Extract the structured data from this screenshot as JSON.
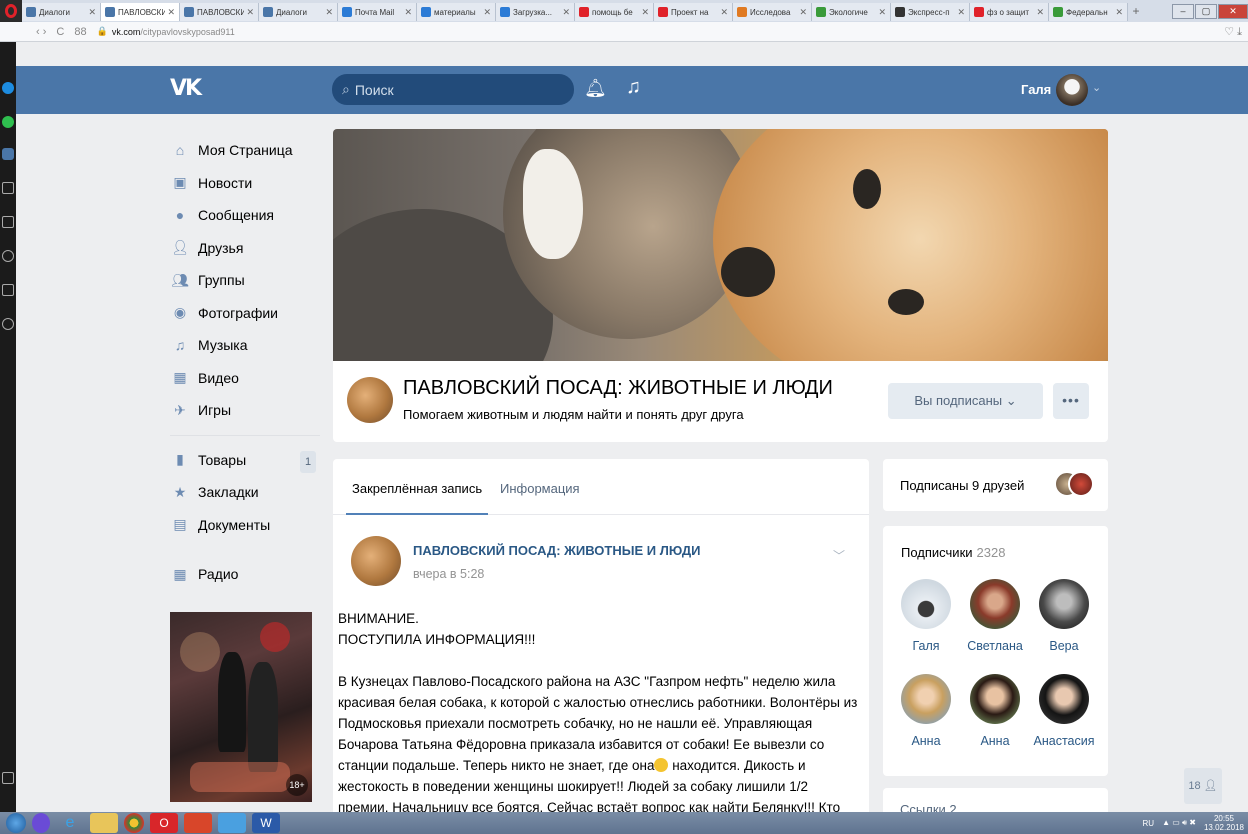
{
  "browser": {
    "tabs": [
      {
        "label": "Диалоги",
        "color": "#4a76a8"
      },
      {
        "label": "ПАВЛОВСКИ",
        "color": "#4a76a8",
        "active": true
      },
      {
        "label": "ПАВЛОВСКИ",
        "color": "#4a76a8"
      },
      {
        "label": "Диалоги",
        "color": "#4a76a8"
      },
      {
        "label": "Почта Mail",
        "color": "#2b7bd6"
      },
      {
        "label": "материалы",
        "color": "#2b7bd6"
      },
      {
        "label": "Загрузка...",
        "color": "#2b7bd6"
      },
      {
        "label": "помощь бе",
        "color": "#e0222a"
      },
      {
        "label": "Проект на",
        "color": "#e0222a"
      },
      {
        "label": "Исследова",
        "color": "#e07a22"
      },
      {
        "label": "Экологиче",
        "color": "#3a9b3a"
      },
      {
        "label": "Экспресс-п",
        "color": "#333333"
      },
      {
        "label": "фз о защит",
        "color": "#e0222a"
      },
      {
        "label": "Федеральн",
        "color": "#3a9b3a"
      }
    ],
    "url_domain": "vk.com",
    "url_path": "/citypavlovskyposad911"
  },
  "header": {
    "logo": "VK",
    "search_placeholder": "Поиск",
    "user_name": "Галя"
  },
  "nav": {
    "items": [
      {
        "label": "Моя Страница",
        "icon": "home-icon"
      },
      {
        "label": "Новости",
        "icon": "news-icon"
      },
      {
        "label": "Сообщения",
        "icon": "messages-icon"
      },
      {
        "label": "Друзья",
        "icon": "friends-icon"
      },
      {
        "label": "Группы",
        "icon": "groups-icon"
      },
      {
        "label": "Фотографии",
        "icon": "photos-icon"
      },
      {
        "label": "Музыка",
        "icon": "music-icon"
      },
      {
        "label": "Видео",
        "icon": "video-icon"
      },
      {
        "label": "Игры",
        "icon": "games-icon"
      }
    ],
    "secondary": [
      {
        "label": "Товары",
        "icon": "market-icon"
      },
      {
        "label": "Закладки",
        "icon": "bookmarks-icon"
      },
      {
        "label": "Документы",
        "icon": "documents-icon"
      }
    ],
    "market_badge": "1",
    "radio": "Радио",
    "ad_age": "18+"
  },
  "group": {
    "title": "ПАВЛОВСКИЙ ПОСАД: ЖИВОТНЫЕ И ЛЮДИ",
    "subtitle": "Помогаем животным и людям найти и понять друг друга",
    "subscribed_label": "Вы подписаны",
    "more_label": "•••"
  },
  "post": {
    "tab_pinned": "Закреплённая запись",
    "tab_info": "Информация",
    "author": "ПАВЛОВСКИЙ ПОСАД: ЖИВОТНЫЕ И ЛЮДИ",
    "time": "вчера в 5:28",
    "line1": "ВНИМАНИЕ.",
    "line2": "ПОСТУПИЛА ИНФОРМАЦИЯ!!!",
    "para_before_emoji": "В Кузнецах Павлово-Посадского района на АЗС \"Газпром нефть\" неделю жила красивая белая собака, к которой с жалостью отнеслись работники. Волонтёры из Подмосковья приехали посмотреть собачку, но не нашли её. Управляющая Бочарова Татьяна Фёдоровна приказала избавится от собаки! Ее вывезли со станции подальше. Теперь никто не знает, где она",
    "para_after_emoji": " находится. Дикость и жестокость в поведении женщины шокирует!! Людей за собаку лишили 1/2 премии. Начальницу все боятся. Сейчас встаёт вопрос как найти Белянку!!! Кто"
  },
  "right": {
    "friends_label": "Подписаны 9 друзей",
    "subs_title": "Подписчики",
    "subs_count": "2328",
    "subscribers": [
      {
        "name": "Галя"
      },
      {
        "name": "Светлана"
      },
      {
        "name": "Вера"
      },
      {
        "name": "Анна"
      },
      {
        "name": "Анна"
      },
      {
        "name": "Анастасия"
      }
    ],
    "links_label": "Ссылки 2",
    "online_count": "18"
  },
  "taskbar": {
    "lang": "RU",
    "time": "20:55",
    "date": "13.02.2018"
  }
}
